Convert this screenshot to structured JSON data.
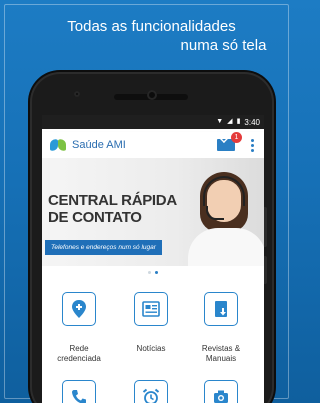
{
  "promo": {
    "headline_line1": "Todas as funcionalidades",
    "headline_line2": "numa só tela"
  },
  "status_bar": {
    "time": "3:40",
    "icons": [
      "wifi-icon",
      "signal-icon",
      "battery-icon"
    ]
  },
  "app_bar": {
    "title": "Saúde AMI",
    "mail_badge": "1",
    "icons": [
      "logo-icon",
      "mail-icon",
      "overflow-menu-icon"
    ]
  },
  "banner": {
    "title_line1": "CENTRAL RÁPIDA",
    "title_line2": "DE CONTATO",
    "tagline": "Telefones e endereços num só lugar",
    "slide_count": 2,
    "active_slide": 2
  },
  "grid": {
    "items": [
      {
        "label": "Rede credenciada",
        "label_line1": "Rede",
        "label_line2": "credenciada",
        "icon": "location-pin-icon"
      },
      {
        "label": "Notícias",
        "icon": "newspaper-icon"
      },
      {
        "label": "Revistas & Manuais",
        "label_line1": "Revistas &",
        "label_line2": "Manuais",
        "icon": "magazine-download-icon"
      },
      {
        "label": "",
        "icon": "phone-icon"
      },
      {
        "label": "",
        "icon": "alarm-clock-icon"
      },
      {
        "label": "",
        "icon": "camera-icon"
      }
    ]
  },
  "colors": {
    "background": "#1670b6",
    "accent": "#2a86cc",
    "badge": "#e43b3b",
    "banner_tag": "#1f6fb8"
  }
}
